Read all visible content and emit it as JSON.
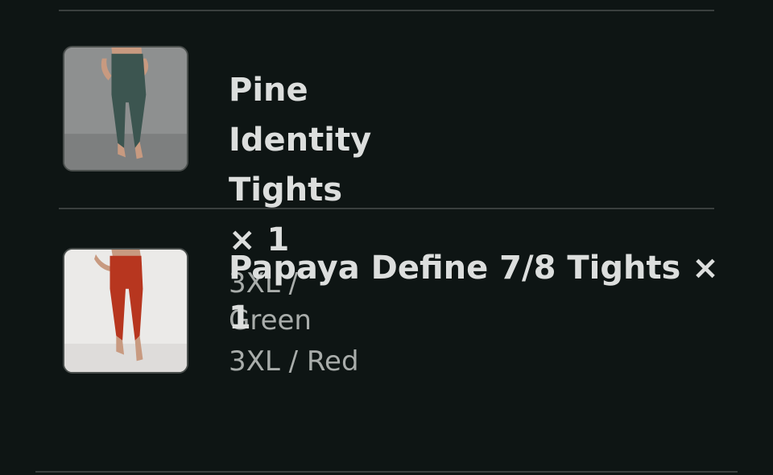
{
  "cart": {
    "items": [
      {
        "name": "Pine Identity Tights × 1",
        "variant": "3XL / Green",
        "product_color": "#3c5550",
        "image_icon": "product-image"
      },
      {
        "name": "Papaya Define 7/8 Tights × 1",
        "variant": "3XL / Red",
        "product_color": "#b7361f",
        "image_icon": "product-image"
      }
    ]
  },
  "colors": {
    "background": "#0e1514",
    "divider": "#3a3f3e",
    "title_text": "#dcdedd",
    "variant_text": "#a9adab"
  }
}
